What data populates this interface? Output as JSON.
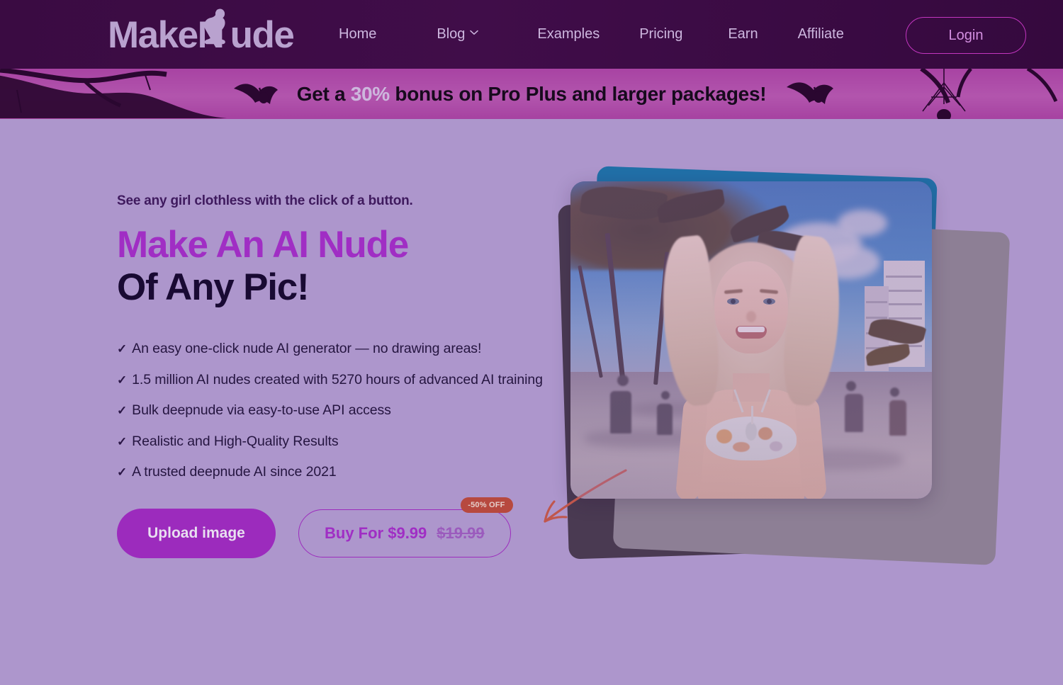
{
  "brand": {
    "name_part1": "Make",
    "name_n": "N",
    "name_part2": "ude",
    "logo_icon": "kneeling-woman-silhouette",
    "logo_color": "#b9a2cf",
    "header_bg": "#3a0b42"
  },
  "nav": {
    "items": [
      {
        "label": "Home",
        "has_dropdown": false
      },
      {
        "label": "Blog",
        "has_dropdown": true,
        "dropdown_icon": "chevron-down-icon"
      },
      {
        "label": "Examples",
        "has_dropdown": false
      },
      {
        "label": "Pricing",
        "has_dropdown": false
      },
      {
        "label": "Earn",
        "has_dropdown": false
      },
      {
        "label": "Affiliate",
        "has_dropdown": false
      }
    ],
    "login_label": "Login",
    "login_border_color": "#c336c0",
    "login_text_color": "#d38fe0"
  },
  "banner": {
    "text_before": "Get a ",
    "highlight": "30%",
    "text_after": " bonus on Pro Plus and larger packages!",
    "full_text": "Get a 30% bonus on Pro Plus and larger packages!",
    "bg_color": "#ae47a8",
    "highlight_color": "#cdb7dd",
    "decorations": [
      "tree-branch-silhouette",
      "bat-silhouette",
      "spider-web-silhouette"
    ]
  },
  "hero": {
    "eyebrow": "See any girl clothless with the click of a button.",
    "headline_line1": "Make An AI Nude",
    "headline_line2": "Of Any Pic!",
    "headline_line1_color": "#a02ec4",
    "headline_line2_color": "#190a33",
    "features": [
      {
        "icon": "check-icon",
        "text": "An easy one-click nude AI generator — no drawing areas!"
      },
      {
        "icon": "check-icon",
        "text": "1.5 million AI nudes created with 5270 hours of advanced AI training"
      },
      {
        "icon": "check-icon",
        "text": "Bulk deepnude via easy-to-use API access"
      },
      {
        "icon": "check-icon",
        "text": "Realistic and High-Quality Results"
      },
      {
        "icon": "check-icon",
        "text": "A trusted deepnude AI since 2021"
      }
    ],
    "upload_button": "Upload image",
    "buy_button_label": "Buy For $9.99",
    "buy_price_current": "$9.99",
    "buy_price_old": "$19.99",
    "discount_badge": "-50% OFF",
    "discount_badge_color": "#b7493f",
    "accent_purple": "#9c2bbd",
    "arrow_color": "#c0564c",
    "page_bg": "#ad96cc",
    "image_alt": "smiling blonde woman in floral bikini on a palm-lined beach promenade"
  }
}
